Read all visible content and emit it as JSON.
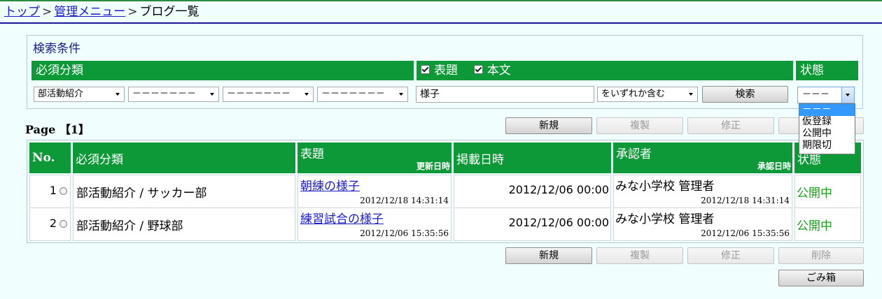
{
  "breadcrumb": {
    "top": "トップ",
    "sep": ">",
    "menu": "管理メニュー",
    "current": "ブログ一覧"
  },
  "search": {
    "title": "検索条件",
    "category_header": "必須分類",
    "title_check": "表題",
    "body_check": "本文",
    "status_header": "状態",
    "select1": "部活動紹介",
    "select2": "－－－－－－－",
    "select3": "－－－－－－－",
    "select4": "－－－－－－－",
    "keyword": "様子",
    "match_mode": "をいずれか含む",
    "search_button": "検索",
    "status_value": "－－－",
    "status_options": [
      "－－－",
      "仮登録",
      "公開中",
      "期限切"
    ]
  },
  "page_label": "Page 【1】",
  "toolbar": {
    "new": "新規",
    "copy": "複製",
    "edit": "修正",
    "delete": "削除",
    "trash": "ごみ箱"
  },
  "table": {
    "headers": {
      "no": "No.",
      "category": "必須分類",
      "title": "表題",
      "updated": "更新日時",
      "published": "掲載日時",
      "approver": "承認者",
      "approved": "承認日時",
      "status": "状態"
    },
    "rows": [
      {
        "no": "1",
        "category": "部活動紹介 / サッカー部",
        "title": "朝練の様子",
        "updated": "2012/12/18 14:31:14",
        "published": "2012/12/06 00:00",
        "approver": "みな小学校 管理者",
        "approved": "2012/12/18 14:31:14",
        "status": "公開中"
      },
      {
        "no": "2",
        "category": "部活動紹介 / 野球部",
        "title": "練習試合の様子",
        "updated": "2012/12/06 15:35:56",
        "published": "2012/12/06 00:00",
        "approver": "みな小学校 管理者",
        "approved": "2012/12/06 15:35:56",
        "status": "公開中"
      }
    ]
  },
  "colors": {
    "header_green": "#0d9937",
    "link_blue": "#1a1acc",
    "status_green": "#19a019"
  }
}
